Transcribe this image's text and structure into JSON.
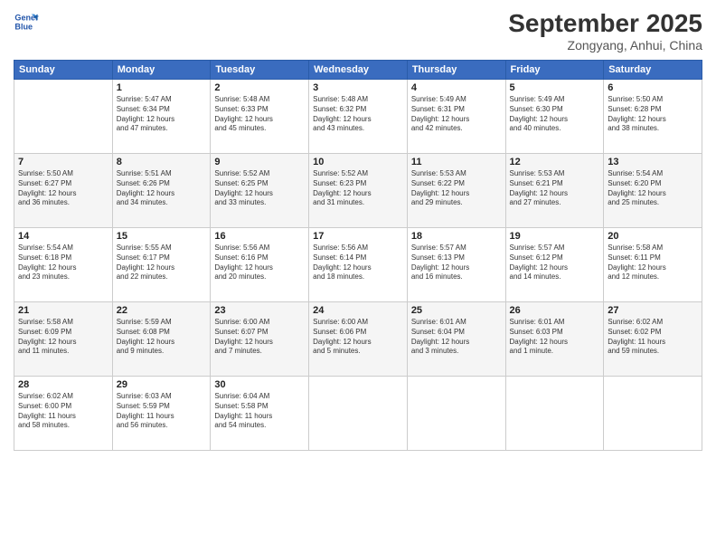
{
  "header": {
    "logo_line1": "General",
    "logo_line2": "Blue",
    "month": "September 2025",
    "location": "Zongyang, Anhui, China"
  },
  "days_of_week": [
    "Sunday",
    "Monday",
    "Tuesday",
    "Wednesday",
    "Thursday",
    "Friday",
    "Saturday"
  ],
  "weeks": [
    [
      {
        "day": "",
        "info": ""
      },
      {
        "day": "1",
        "info": "Sunrise: 5:47 AM\nSunset: 6:34 PM\nDaylight: 12 hours\nand 47 minutes."
      },
      {
        "day": "2",
        "info": "Sunrise: 5:48 AM\nSunset: 6:33 PM\nDaylight: 12 hours\nand 45 minutes."
      },
      {
        "day": "3",
        "info": "Sunrise: 5:48 AM\nSunset: 6:32 PM\nDaylight: 12 hours\nand 43 minutes."
      },
      {
        "day": "4",
        "info": "Sunrise: 5:49 AM\nSunset: 6:31 PM\nDaylight: 12 hours\nand 42 minutes."
      },
      {
        "day": "5",
        "info": "Sunrise: 5:49 AM\nSunset: 6:30 PM\nDaylight: 12 hours\nand 40 minutes."
      },
      {
        "day": "6",
        "info": "Sunrise: 5:50 AM\nSunset: 6:28 PM\nDaylight: 12 hours\nand 38 minutes."
      }
    ],
    [
      {
        "day": "7",
        "info": "Sunrise: 5:50 AM\nSunset: 6:27 PM\nDaylight: 12 hours\nand 36 minutes."
      },
      {
        "day": "8",
        "info": "Sunrise: 5:51 AM\nSunset: 6:26 PM\nDaylight: 12 hours\nand 34 minutes."
      },
      {
        "day": "9",
        "info": "Sunrise: 5:52 AM\nSunset: 6:25 PM\nDaylight: 12 hours\nand 33 minutes."
      },
      {
        "day": "10",
        "info": "Sunrise: 5:52 AM\nSunset: 6:23 PM\nDaylight: 12 hours\nand 31 minutes."
      },
      {
        "day": "11",
        "info": "Sunrise: 5:53 AM\nSunset: 6:22 PM\nDaylight: 12 hours\nand 29 minutes."
      },
      {
        "day": "12",
        "info": "Sunrise: 5:53 AM\nSunset: 6:21 PM\nDaylight: 12 hours\nand 27 minutes."
      },
      {
        "day": "13",
        "info": "Sunrise: 5:54 AM\nSunset: 6:20 PM\nDaylight: 12 hours\nand 25 minutes."
      }
    ],
    [
      {
        "day": "14",
        "info": "Sunrise: 5:54 AM\nSunset: 6:18 PM\nDaylight: 12 hours\nand 23 minutes."
      },
      {
        "day": "15",
        "info": "Sunrise: 5:55 AM\nSunset: 6:17 PM\nDaylight: 12 hours\nand 22 minutes."
      },
      {
        "day": "16",
        "info": "Sunrise: 5:56 AM\nSunset: 6:16 PM\nDaylight: 12 hours\nand 20 minutes."
      },
      {
        "day": "17",
        "info": "Sunrise: 5:56 AM\nSunset: 6:14 PM\nDaylight: 12 hours\nand 18 minutes."
      },
      {
        "day": "18",
        "info": "Sunrise: 5:57 AM\nSunset: 6:13 PM\nDaylight: 12 hours\nand 16 minutes."
      },
      {
        "day": "19",
        "info": "Sunrise: 5:57 AM\nSunset: 6:12 PM\nDaylight: 12 hours\nand 14 minutes."
      },
      {
        "day": "20",
        "info": "Sunrise: 5:58 AM\nSunset: 6:11 PM\nDaylight: 12 hours\nand 12 minutes."
      }
    ],
    [
      {
        "day": "21",
        "info": "Sunrise: 5:58 AM\nSunset: 6:09 PM\nDaylight: 12 hours\nand 11 minutes."
      },
      {
        "day": "22",
        "info": "Sunrise: 5:59 AM\nSunset: 6:08 PM\nDaylight: 12 hours\nand 9 minutes."
      },
      {
        "day": "23",
        "info": "Sunrise: 6:00 AM\nSunset: 6:07 PM\nDaylight: 12 hours\nand 7 minutes."
      },
      {
        "day": "24",
        "info": "Sunrise: 6:00 AM\nSunset: 6:06 PM\nDaylight: 12 hours\nand 5 minutes."
      },
      {
        "day": "25",
        "info": "Sunrise: 6:01 AM\nSunset: 6:04 PM\nDaylight: 12 hours\nand 3 minutes."
      },
      {
        "day": "26",
        "info": "Sunrise: 6:01 AM\nSunset: 6:03 PM\nDaylight: 12 hours\nand 1 minute."
      },
      {
        "day": "27",
        "info": "Sunrise: 6:02 AM\nSunset: 6:02 PM\nDaylight: 11 hours\nand 59 minutes."
      }
    ],
    [
      {
        "day": "28",
        "info": "Sunrise: 6:02 AM\nSunset: 6:00 PM\nDaylight: 11 hours\nand 58 minutes."
      },
      {
        "day": "29",
        "info": "Sunrise: 6:03 AM\nSunset: 5:59 PM\nDaylight: 11 hours\nand 56 minutes."
      },
      {
        "day": "30",
        "info": "Sunrise: 6:04 AM\nSunset: 5:58 PM\nDaylight: 11 hours\nand 54 minutes."
      },
      {
        "day": "",
        "info": ""
      },
      {
        "day": "",
        "info": ""
      },
      {
        "day": "",
        "info": ""
      },
      {
        "day": "",
        "info": ""
      }
    ]
  ]
}
